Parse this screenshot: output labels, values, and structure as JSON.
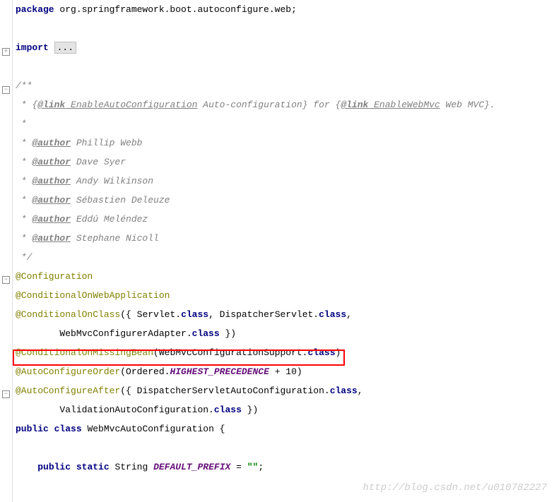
{
  "package_kw": "package",
  "package_name": " org.springframework.boot.autoconfigure.web;",
  "import_kw": "import",
  "import_fold": "...",
  "javadoc": {
    "open": "/**",
    "l1_a": " * {",
    "l1_link1": "@link",
    "l1_cls1": " EnableAutoConfiguration",
    "l1_b": " Auto-configuration} for {",
    "l1_link2": "@link",
    "l1_cls2": " EnableWebMvc",
    "l1_c": " Web MVC}.",
    "l2": " *",
    "author_tag": "@author",
    "authors": [
      " Phillip Webb",
      " Dave Syer",
      " Andy Wilkinson",
      " Sébastien Deleuze",
      " Eddú Meléndez",
      " Stephane Nicoll"
    ],
    "close": " */"
  },
  "ann1": "@Configuration",
  "ann2": "@ConditionalOnWebApplication",
  "ann3_a": "@ConditionalOnClass",
  "ann3_b": "({ Servlet.",
  "ann3_c": ", DispatcherServlet.",
  "ann3_d": ",",
  "ann3_e": "        WebMvcConfigurerAdapter.",
  "ann3_f": " })",
  "ann4_a": "@ConditionalOnMissingBean",
  "ann4_b": "(WebMvcConfigurationSupport.",
  "ann4_c": ")",
  "ann5_a": "@AutoConfigureOrder",
  "ann5_b": "(Ordered.",
  "ann5_const": "HIGHEST_PRECEDENCE",
  "ann5_c": " + 10)",
  "ann6_a": "@AutoConfigureAfter",
  "ann6_b": "({ DispatcherServletAutoConfiguration.",
  "ann6_c": ",",
  "ann6_d": "        ValidationAutoConfiguration.",
  "ann6_e": " })",
  "class_kw1": "public",
  "class_kw2": "class",
  "class_name": " WebMvcAutoConfiguration {",
  "field_kw1": "public",
  "field_kw2": "static",
  "field_type": " String ",
  "field_name": "DEFAULT_PREFIX",
  "field_eq": " = ",
  "field_val": "\"\"",
  "field_end": ";",
  "class_kw": "class",
  "watermark": "http://blog.csdn.net/u010782227"
}
